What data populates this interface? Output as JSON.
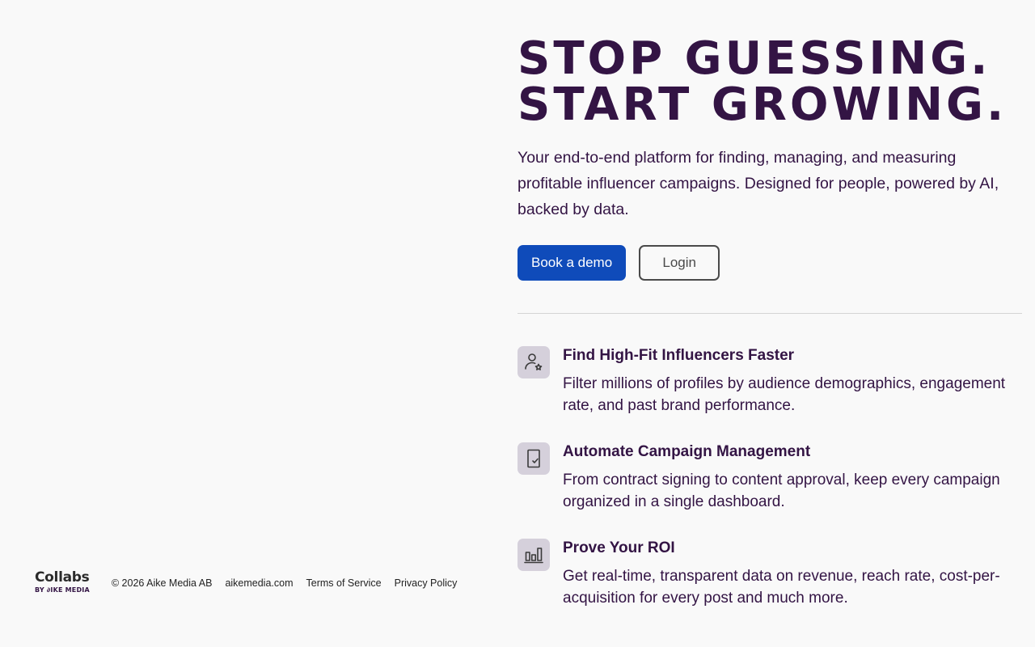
{
  "hero": {
    "headline_line1": "STOP GUESSING.",
    "headline_line2": "START GROWING.",
    "subtitle": "Your end-to-end platform for finding, managing, and measuring profitable influencer campaigns. Designed for people, powered by AI, backed by data.",
    "primary_button": "Book a demo",
    "secondary_button": "Login"
  },
  "features": [
    {
      "icon": "user-star-icon",
      "title": "Find High-Fit Influencers Faster",
      "description": "Filter millions of profiles by audience demographics, engagement rate, and past brand performance."
    },
    {
      "icon": "document-check-icon",
      "title": "Automate Campaign Management",
      "description": "From contract signing to content approval, keep every campaign organized in a single dashboard."
    },
    {
      "icon": "bar-chart-icon",
      "title": "Prove Your ROI",
      "description": "Get real-time, transparent data on revenue, reach rate, cost-per-acquisition for every post and much more."
    }
  ],
  "footer": {
    "logo_main": "Collabs",
    "logo_sub": "BY ∂IKE MEDIA",
    "copyright": "© 2026 Aike Media AB",
    "links": [
      "aikemedia.com",
      "Terms of Service",
      "Privacy Policy"
    ]
  },
  "colors": {
    "background": "#f9f9f9",
    "text": "#331444",
    "primary": "#0f4bba",
    "icon_bg": "#d5d0db"
  }
}
